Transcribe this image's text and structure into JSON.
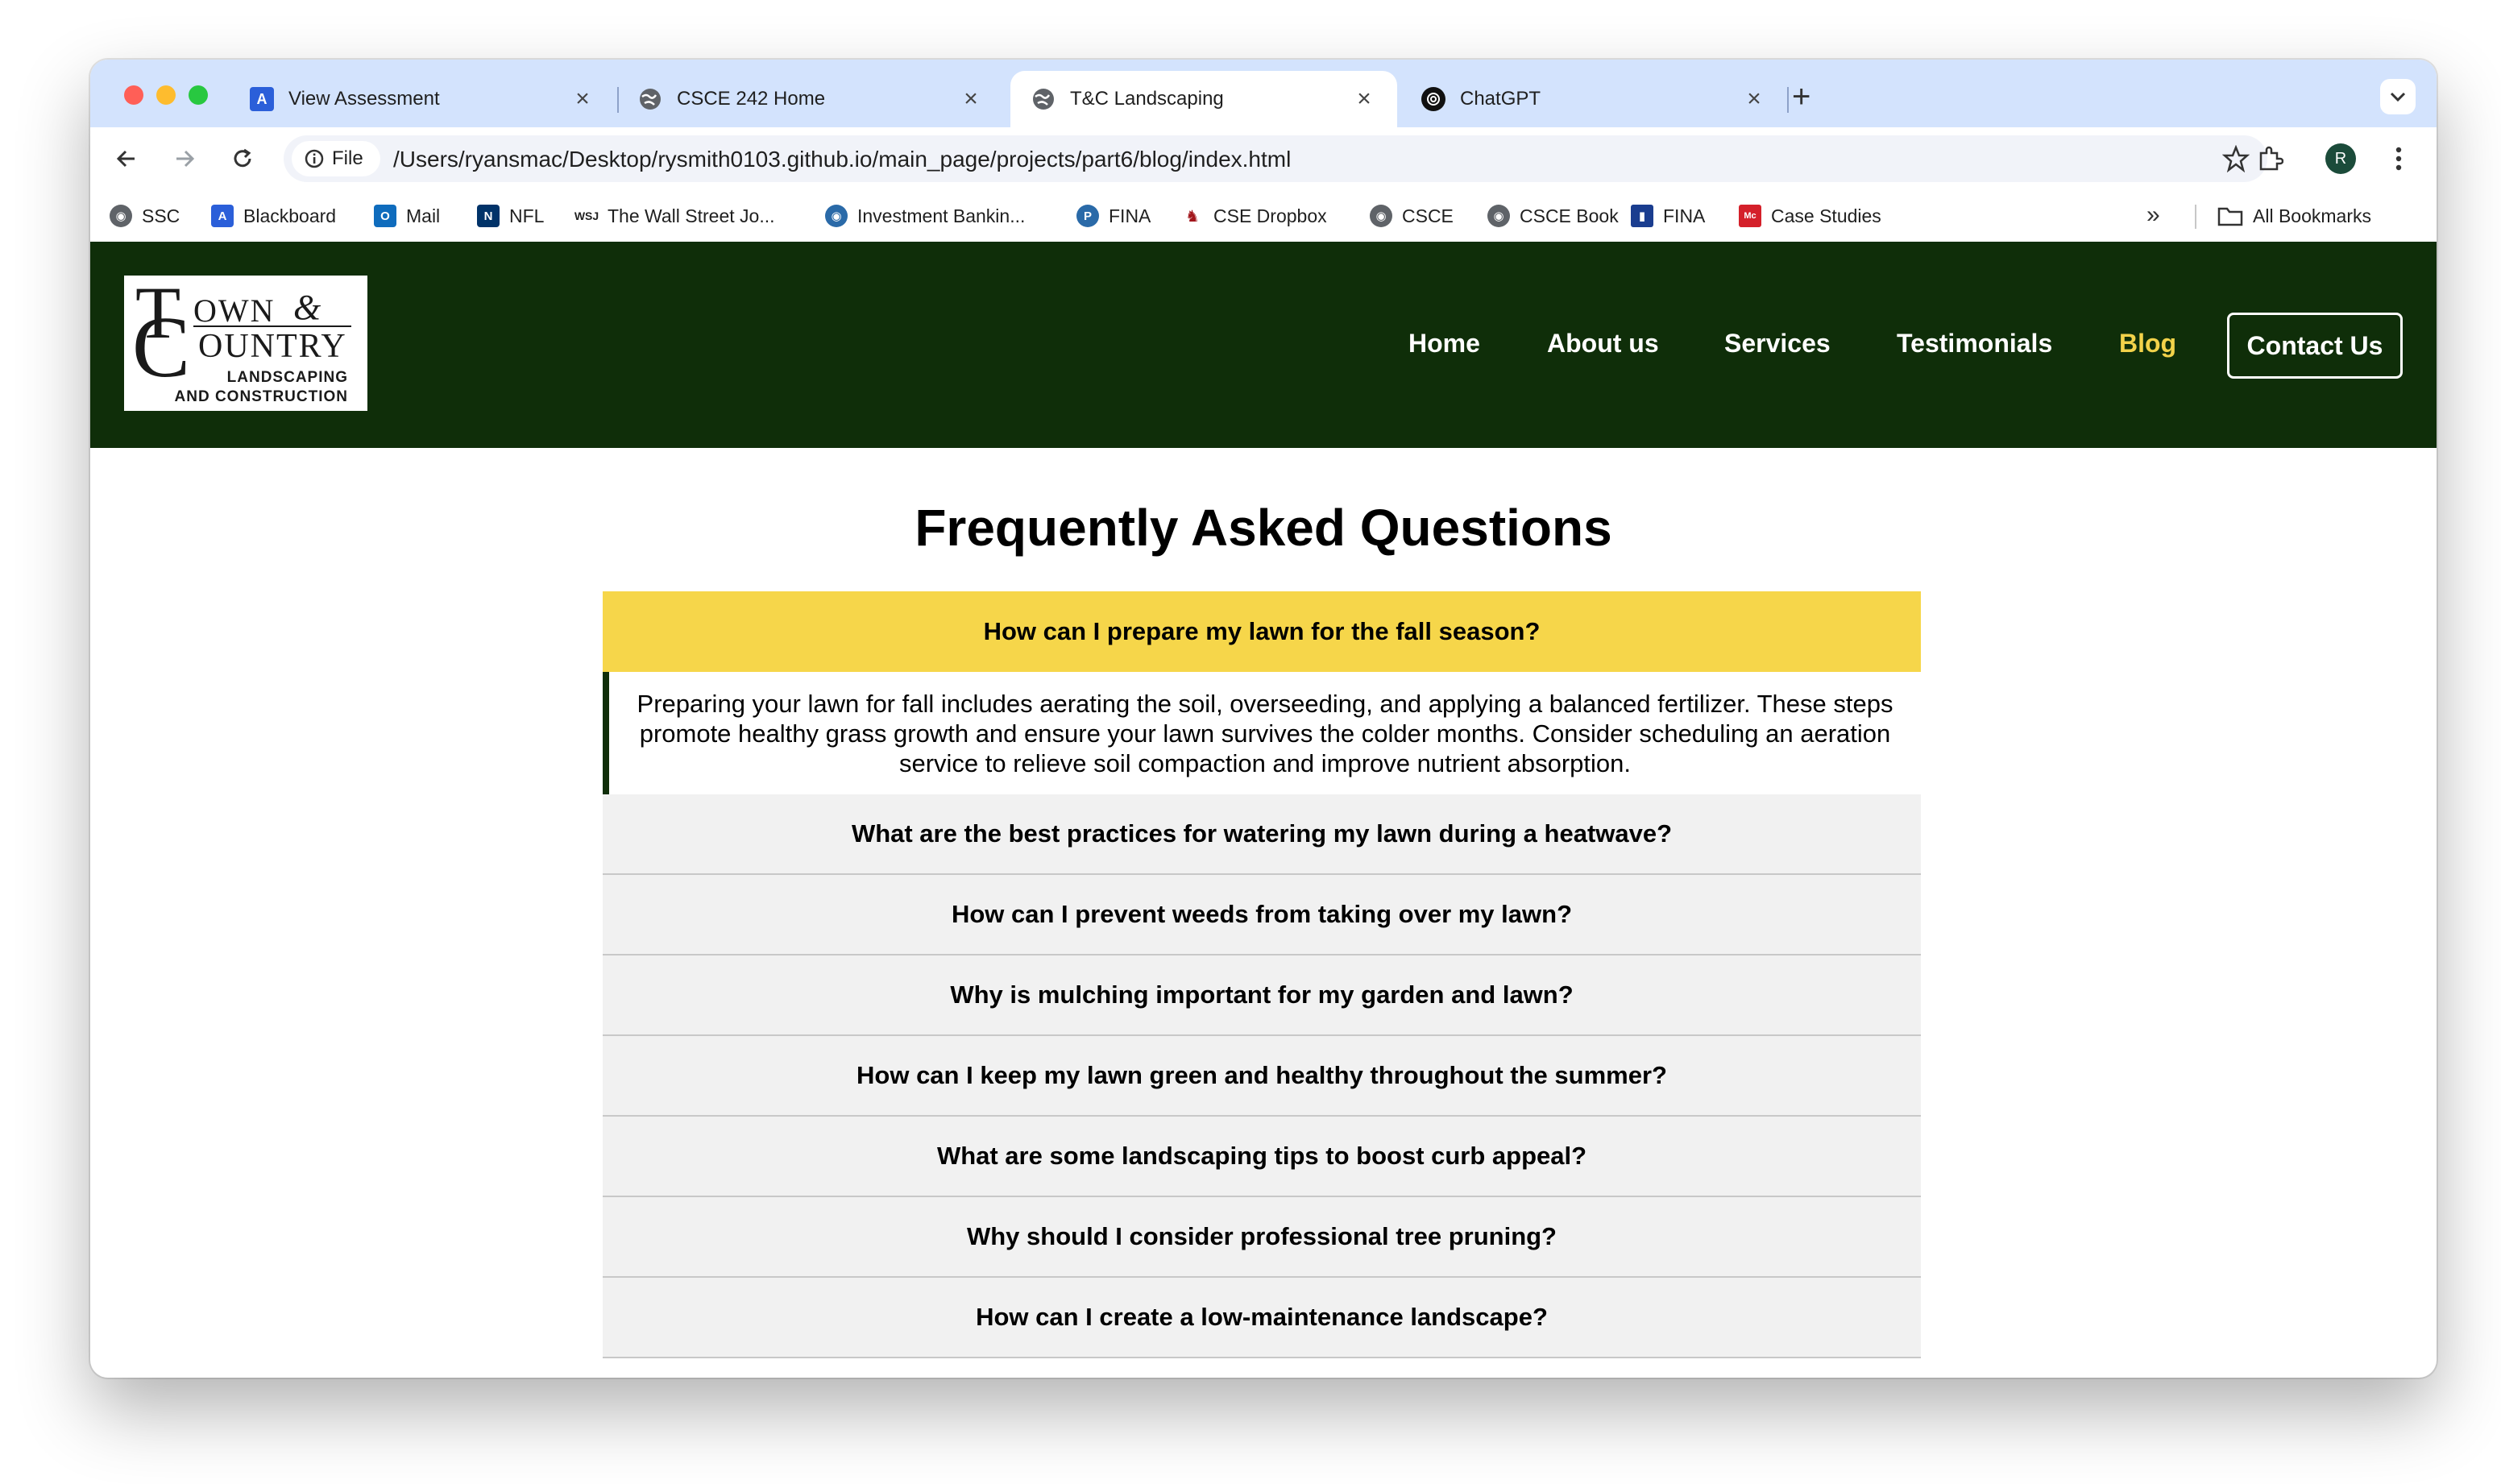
{
  "browser": {
    "tabs": [
      {
        "title": "View Assessment",
        "icon": "anthology-icon",
        "color": "#2b5fd9",
        "glyph": "A"
      },
      {
        "title": "CSCE 242 Home",
        "icon": "globe-icon",
        "color": "#5f6368",
        "glyph": ""
      },
      {
        "title": "T&C Landscaping",
        "icon": "globe-icon",
        "color": "#5f6368",
        "glyph": ""
      },
      {
        "title": "ChatGPT",
        "icon": "chatgpt-icon",
        "color": "#111111",
        "glyph": ""
      }
    ],
    "active_tab_index": 2,
    "address": {
      "scheme_label": "File",
      "url": "/Users/ryansmac/Desktop/rysmith0103.github.io/main_page/projects/part6/blog/index.html"
    },
    "profile_initial": "R",
    "bookmarks": [
      {
        "label": "SSC",
        "icon": "globe-icon"
      },
      {
        "label": "Blackboard",
        "icon": "blackboard-icon"
      },
      {
        "label": "Mail",
        "icon": "outlook-icon"
      },
      {
        "label": "NFL",
        "icon": "nfl-icon"
      },
      {
        "label": "The Wall Street Jo...",
        "icon": "wsj-icon"
      },
      {
        "label": "Investment Bankin...",
        "icon": "globe-icon"
      },
      {
        "label": "FINA",
        "icon": "p-icon"
      },
      {
        "label": "CSE Dropbox",
        "icon": "dropbox-icon"
      },
      {
        "label": "CSCE",
        "icon": "globe-icon"
      },
      {
        "label": "CSCE Book",
        "icon": "globe-icon"
      },
      {
        "label": "FINA",
        "icon": "flag-icon"
      },
      {
        "label": "Case Studies",
        "icon": "mcgraw-icon"
      }
    ],
    "all_bookmarks_label": "All Bookmarks"
  },
  "site": {
    "logo": {
      "letter_t": "T",
      "own": "OWN",
      "amp": "&",
      "letter_c": "C",
      "ountry": "OUNTRY",
      "sub1": "LANDSCAPING",
      "sub2": "AND CONSTRUCTION"
    },
    "nav": {
      "home": "Home",
      "about": "About us",
      "services": "Services",
      "testimonials": "Testimonials",
      "blog": "Blog",
      "contact": "Contact Us"
    },
    "colors": {
      "header_bg": "#0f2e09",
      "accent": "#f2d24a",
      "open_question_bg": "#f6d64a"
    }
  },
  "faq": {
    "title": "Frequently Asked Questions",
    "open_question": "How can I prepare my lawn for the fall season?",
    "open_answer": "Preparing your lawn for fall includes aerating the soil, overseeding, and applying a balanced fertilizer. These steps promote healthy grass growth and ensure your lawn survives the colder months. Consider scheduling an aeration service to relieve soil compaction and improve nutrient absorption.",
    "questions": [
      "What are the best practices for watering my lawn during a heatwave?",
      "How can I prevent weeds from taking over my lawn?",
      "Why is mulching important for my garden and lawn?",
      "How can I keep my lawn green and healthy throughout the summer?",
      "What are some landscaping tips to boost curb appeal?",
      "Why should I consider professional tree pruning?",
      "How can I create a low-maintenance landscape?"
    ]
  }
}
